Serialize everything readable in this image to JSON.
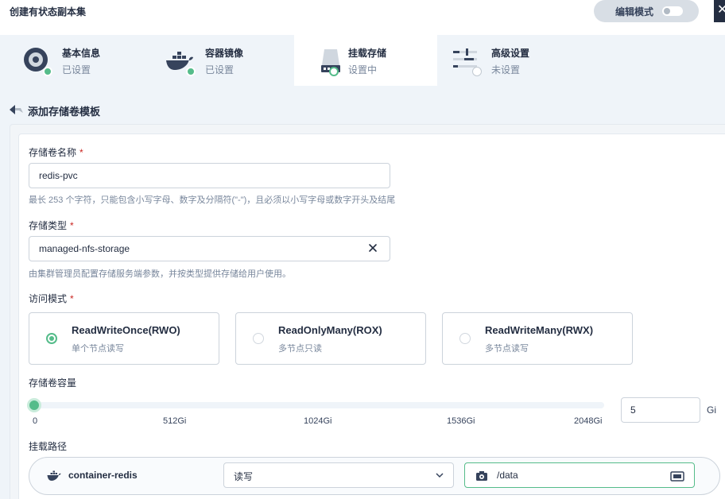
{
  "window": {
    "title": "创建有状态副本集",
    "edit_mode_label": "编辑模式",
    "close_glyph": "✕"
  },
  "steps": [
    {
      "title": "基本信息",
      "status": "已设置",
      "icon": "disk-icon",
      "state": "done"
    },
    {
      "title": "容器镜像",
      "status": "已设置",
      "icon": "docker-icon",
      "state": "done"
    },
    {
      "title": "挂载存储",
      "status": "设置中",
      "icon": "storage-icon",
      "state": "active"
    },
    {
      "title": "高级设置",
      "status": "未设置",
      "icon": "sliders-icon",
      "state": "pending"
    }
  ],
  "back": {
    "label": "添加存储卷模板",
    "icon": "back-arrow-icon"
  },
  "form": {
    "name": {
      "label": "存储卷名称",
      "required": "*",
      "value": "redis-pvc",
      "hint": "最长 253 个字符，只能包含小写字母、数字及分隔符(\"-\")，且必须以小写字母或数字开头及结尾"
    },
    "type": {
      "label": "存储类型",
      "required": "*",
      "value": "managed-nfs-storage",
      "hint": "由集群管理员配置存储服务端参数，并按类型提供存储给用户使用。"
    },
    "access": {
      "label": "访问模式",
      "required": "*",
      "options": [
        {
          "title": "ReadWriteOnce(RWO)",
          "sub": "单个节点读写",
          "selected": true
        },
        {
          "title": "ReadOnlyMany(ROX)",
          "sub": "多节点只读",
          "selected": false
        },
        {
          "title": "ReadWriteMany(RWX)",
          "sub": "多节点读写",
          "selected": false
        }
      ]
    },
    "capacity": {
      "label": "存储卷容量",
      "ticks": [
        "0",
        "512Gi",
        "1024Gi",
        "1536Gi",
        "2048Gi"
      ],
      "value": "5",
      "unit": "Gi",
      "max": 2048
    },
    "mount": {
      "label": "挂载路径",
      "container": "container-redis",
      "mode": "读写",
      "path": "/data"
    }
  },
  "colors": {
    "accent": "#55bc8a",
    "text": "#242e42",
    "muted": "#79879c",
    "required": "#ca2621"
  }
}
